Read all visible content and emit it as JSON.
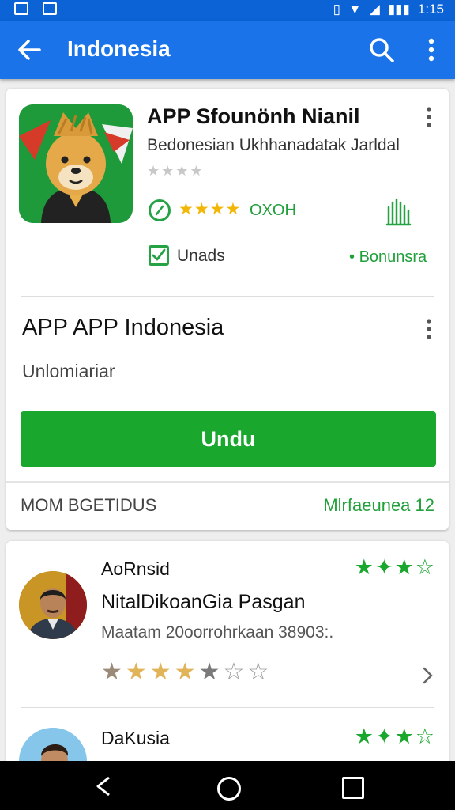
{
  "status_bar": {
    "time": "1:15"
  },
  "app_bar": {
    "title": "Indonesia"
  },
  "app": {
    "name": "APP Sfounönh Nianil",
    "developer": "Bedonesian Ukhhanadatak Jarldal",
    "small_stars": "★★★★",
    "rating_stars": "★★★★",
    "rating_text": "OXOH",
    "checkbox_label": "Unads",
    "bonus_label": "Bonunsra"
  },
  "section": {
    "title": "APP  APP Indonesia",
    "subtitle": "Unlomiariar",
    "install_label": "Undu",
    "footer_left": "MOM BGETIDUS",
    "footer_right": "Mlrfaeunea 12"
  },
  "reviews": [
    {
      "name": "AoRnsid",
      "title": "NitalDikoanGia Pasgan",
      "date": "Maatam 20oorrohrkaan 38903:.",
      "top_stars": "★✦★☆",
      "rating": "★★★★★☆☆"
    },
    {
      "name": "DaKusia",
      "top_stars": "★✦★☆"
    }
  ],
  "colors": {
    "primary": "#1a73e8",
    "status": "#0b63d6",
    "green": "#1aa72e",
    "star": "#f2b705"
  }
}
